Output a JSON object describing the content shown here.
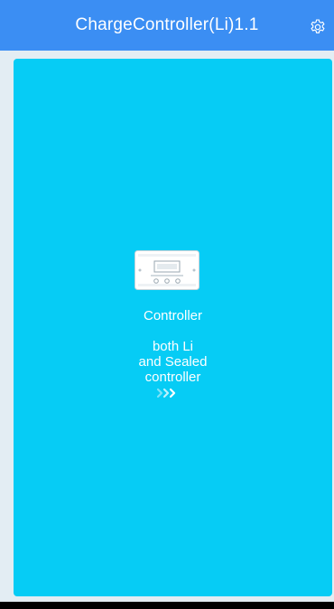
{
  "header": {
    "title": "ChargeController(Li)1.1",
    "settings_icon": "gear-icon",
    "background": "#3b8ef3"
  },
  "card": {
    "title": "Controller",
    "description": "both Li\nand Sealed\ncontroller",
    "image_icon": "charge-controller-device-image",
    "arrow_icon": "triple-chevron-right-icon",
    "background": "#06ccf5"
  }
}
